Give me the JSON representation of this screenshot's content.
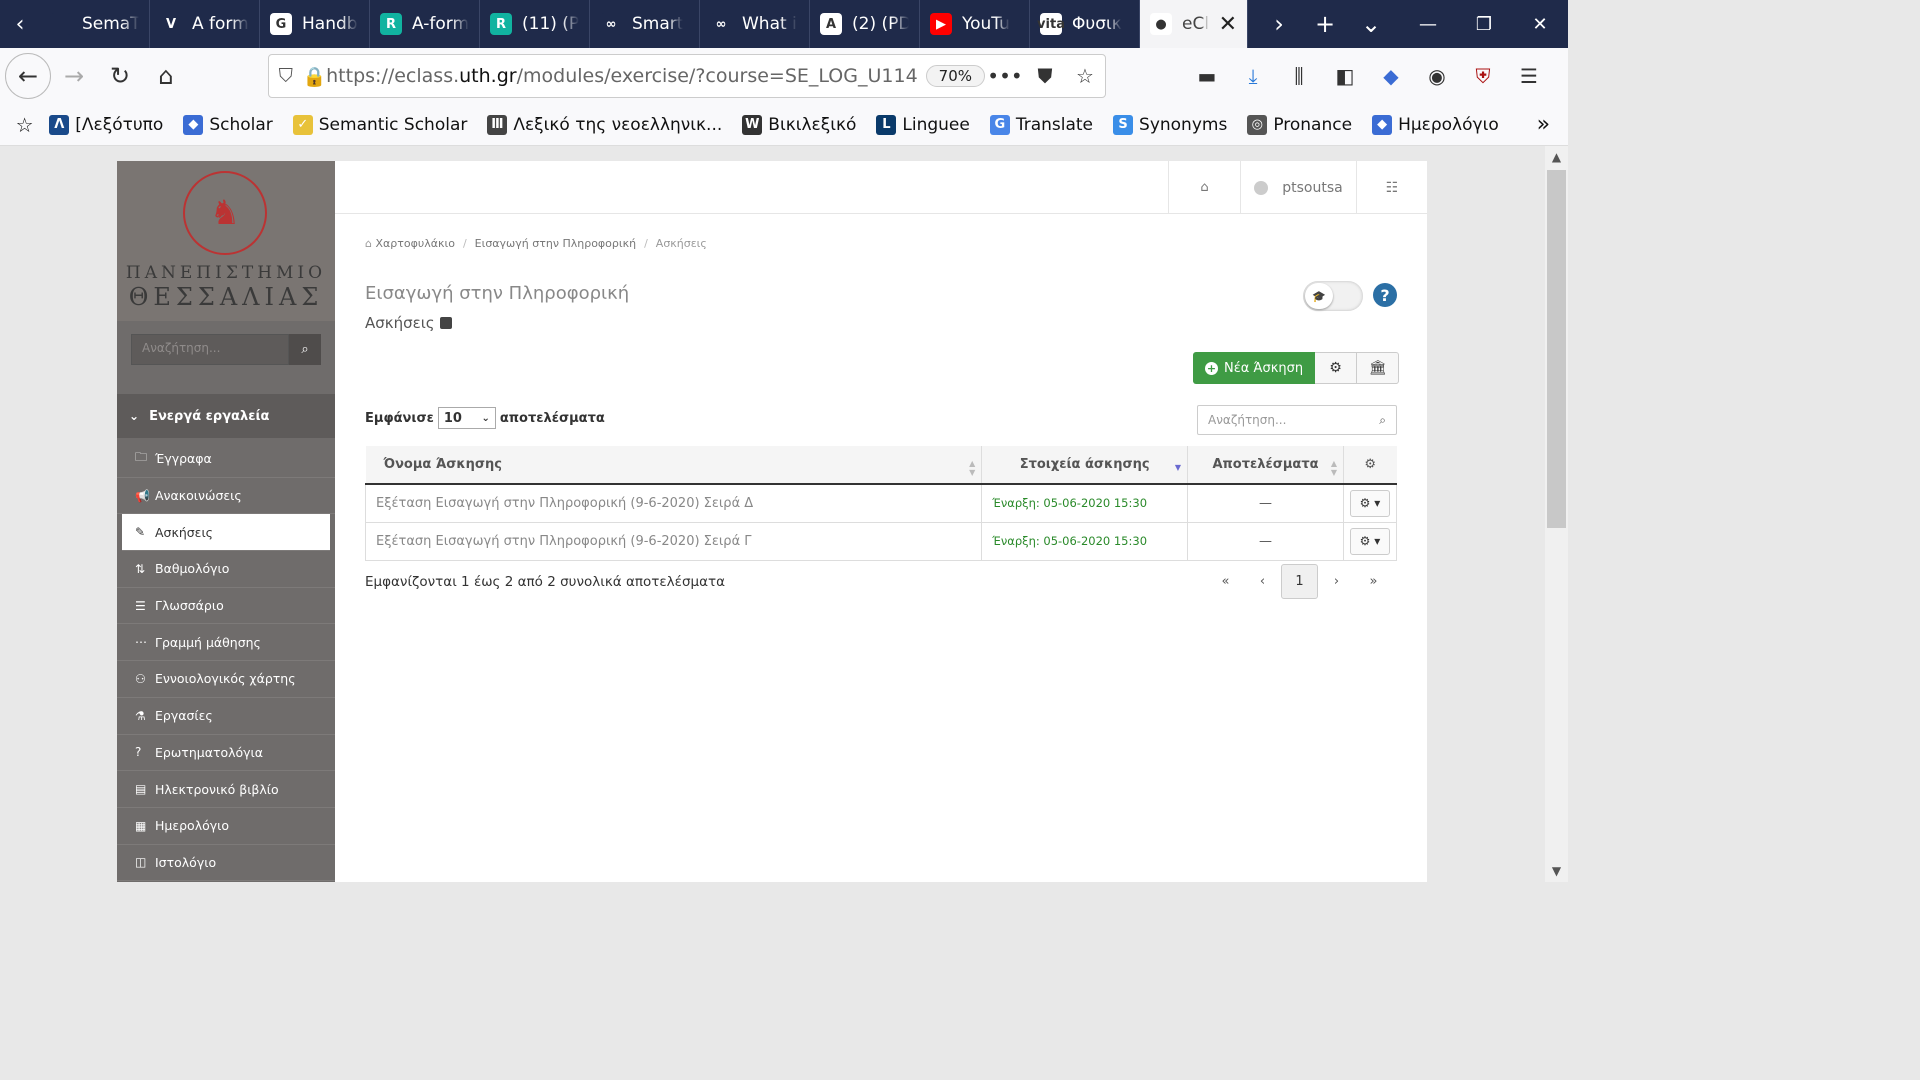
{
  "browser": {
    "tabs": [
      {
        "title": "SemaT",
        "favicon_color": "#1f2a4a",
        "favicon_text": ""
      },
      {
        "title": "A form",
        "favicon_color": "#1f2a4a",
        "favicon_text": "V"
      },
      {
        "title": "Handb",
        "favicon_color": "#ffffff",
        "favicon_text": "G"
      },
      {
        "title": "A-form",
        "favicon_color": "#11b3a0",
        "favicon_text": "R"
      },
      {
        "title": "(11) (P",
        "favicon_color": "#11b3a0",
        "favicon_text": "R"
      },
      {
        "title": "Smart",
        "favicon_color": "#1f2a4a",
        "favicon_text": "∞"
      },
      {
        "title": "What i",
        "favicon_color": "#1f2a4a",
        "favicon_text": "∞"
      },
      {
        "title": "(2) (PD",
        "favicon_color": "#ffffff",
        "favicon_text": "A"
      },
      {
        "title": "YouTu",
        "favicon_color": "#ff0000",
        "favicon_text": "▶"
      },
      {
        "title": "Φυσικ",
        "favicon_color": "#ffffff",
        "favicon_text": "vita"
      },
      {
        "title": "eCl",
        "favicon_color": "#ffffff",
        "favicon_text": "●",
        "active": true
      }
    ],
    "url_prefix": "https://eclass.",
    "url_domain": "uth.gr",
    "url_path": "/modules/exercise/?course=SE_LOG_U114",
    "zoom": "70%",
    "bookmarks": [
      {
        "label": "[Λεξότυπο",
        "color": "#1a4a8a",
        "icon": "Λ"
      },
      {
        "label": "Scholar",
        "color": "#3b6cd4",
        "icon": "◆"
      },
      {
        "label": "Semantic Scholar",
        "color": "#e8c23a",
        "icon": "✓"
      },
      {
        "label": "Λεξικό της νεοελληνικ...",
        "color": "#444444",
        "icon": "Ⅲ"
      },
      {
        "label": "Βικιλεξικό",
        "color": "#333333",
        "icon": "W"
      },
      {
        "label": "Linguee",
        "color": "#0a3a6a",
        "icon": "L"
      },
      {
        "label": "Translate",
        "color": "#4a86e8",
        "icon": "G"
      },
      {
        "label": "Synonyms",
        "color": "#3a8ee8",
        "icon": "S"
      },
      {
        "label": "Pronance",
        "color": "#555555",
        "icon": "◎"
      },
      {
        "label": "Ημερολόγιο",
        "color": "#3b6cd4",
        "icon": "◆"
      }
    ]
  },
  "sidebar": {
    "univ_line1": "ΠΑΝΕΠΙΣΤΗΜΙΟ",
    "univ_line2": "ΘΕΣΣΑΛΙΑΣ",
    "search_placeholder": "Αναζήτηση...",
    "section_title": "Ενεργά εργαλεία",
    "items": [
      {
        "label": "Έγγραφα",
        "icon": "🗀"
      },
      {
        "label": "Ανακοινώσεις",
        "icon": "📢"
      },
      {
        "label": "Ασκήσεις",
        "icon": "✎",
        "active": true
      },
      {
        "label": "Βαθμολόγιο",
        "icon": "⇅"
      },
      {
        "label": "Γλωσσάριο",
        "icon": "☰"
      },
      {
        "label": "Γραμμή μάθησης",
        "icon": "⋯"
      },
      {
        "label": "Εννοιολογικός χάρτης",
        "icon": "⚇"
      },
      {
        "label": "Εργασίες",
        "icon": "⚗"
      },
      {
        "label": "Ερωτηματολόγια",
        "icon": "?"
      },
      {
        "label": "Ηλεκτρονικό βιβλίο",
        "icon": "▤"
      },
      {
        "label": "Ημερολόγιο",
        "icon": "▦"
      },
      {
        "label": "Ιστολόγιο",
        "icon": "◫"
      }
    ]
  },
  "header": {
    "username": "ptsoutsa"
  },
  "breadcrumb": [
    "Χαρτοφυλάκιο",
    "Εισαγωγή στην Πληροφορική",
    "Ασκήσεις"
  ],
  "course_title": "Εισαγωγή στην Πληροφορική",
  "section_title": "Ασκήσεις",
  "new_exercise_label": "Νέα Άσκηση",
  "table": {
    "show_label": "Εμφάνισε",
    "page_size": "10",
    "results_label": "αποτελέσματα",
    "search_placeholder": "Αναζήτηση...",
    "columns": [
      "Όνομα Άσκησης",
      "Στοιχεία άσκησης",
      "Αποτελέσματα"
    ],
    "rows": [
      {
        "name": "Εξέταση Εισαγωγή στην Πληροφορική (9-6-2020) Σειρά Δ",
        "details": "Έναρξη: 05-06-2020 15:30",
        "results": "—"
      },
      {
        "name": "Εξέταση Εισαγωγή στην Πληροφορική (9-6-2020) Σειρά Γ",
        "details": "Έναρξη: 05-06-2020 15:30",
        "results": "—"
      }
    ],
    "summary": "Εμφανίζονται 1 έως 2 από 2 συνολικά αποτελέσματα",
    "pager": [
      "«",
      "‹",
      "1",
      "›",
      "»"
    ],
    "current_page": "1"
  }
}
